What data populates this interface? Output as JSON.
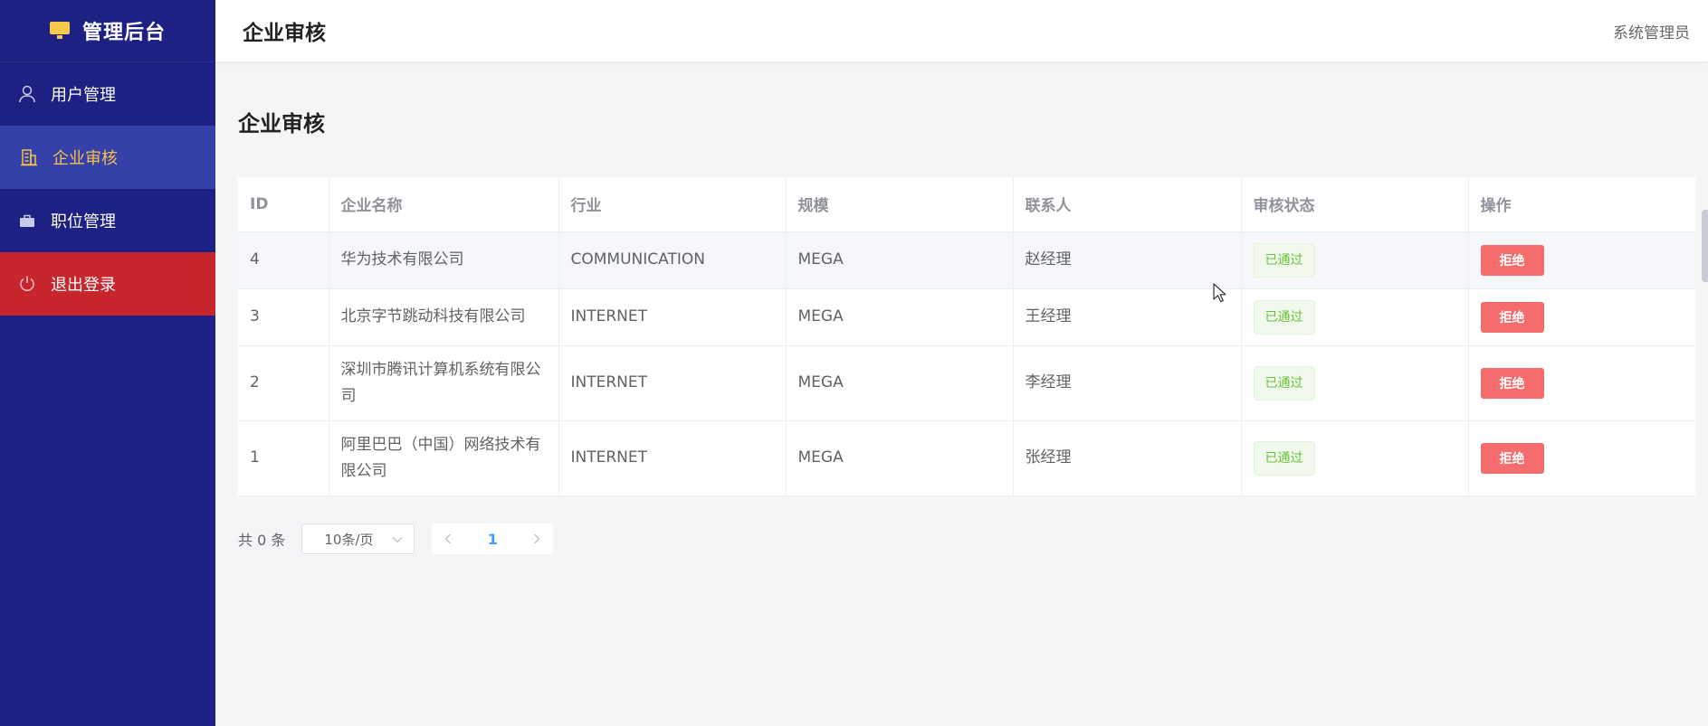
{
  "sidebar": {
    "logo_title": "管理后台",
    "logo_icon": "monitor-icon",
    "items": [
      {
        "label": "用户管理",
        "icon": "user-icon"
      },
      {
        "label": "企业审核",
        "icon": "building-icon",
        "active": true
      },
      {
        "label": "职位管理",
        "icon": "briefcase-icon"
      },
      {
        "label": "退出登录",
        "icon": "power-icon"
      }
    ]
  },
  "header": {
    "title": "企业审核",
    "user": "系统管理员"
  },
  "main": {
    "heading": "企业审核",
    "table": {
      "columns": [
        "ID",
        "企业名称",
        "行业",
        "规模",
        "联系人",
        "审核状态",
        "操作"
      ],
      "rows": [
        {
          "id": "4",
          "name": "华为技术有限公司",
          "industry": "COMMUNICATION",
          "scale": "MEGA",
          "contact": "赵经理",
          "status": "已通过",
          "action": "拒绝"
        },
        {
          "id": "3",
          "name": "北京字节跳动科技有限公司",
          "industry": "INTERNET",
          "scale": "MEGA",
          "contact": "王经理",
          "status": "已通过",
          "action": "拒绝"
        },
        {
          "id": "2",
          "name": "深圳市腾讯计算机系统有限公司",
          "industry": "INTERNET",
          "scale": "MEGA",
          "contact": "李经理",
          "status": "已通过",
          "action": "拒绝"
        },
        {
          "id": "1",
          "name": "阿里巴巴（中国）网络技术有限公司",
          "industry": "INTERNET",
          "scale": "MEGA",
          "contact": "张经理",
          "status": "已通过",
          "action": "拒绝"
        }
      ]
    },
    "pagination": {
      "total": "共 0 条",
      "page_size": "10条/页",
      "current_page": "1"
    }
  },
  "colors": {
    "sidebar_bg": "#1c2183",
    "active_item_bg": "#3540a9",
    "active_item_text": "#f5c24c",
    "logout_bg": "#c7262c",
    "reject_button": "#f56c6c",
    "status_success": "#67c23a",
    "pager_active": "#409eff"
  }
}
